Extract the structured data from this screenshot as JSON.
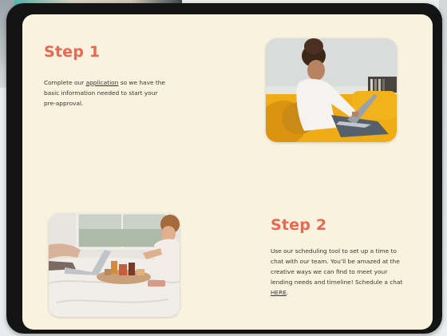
{
  "step1": {
    "title": "Step 1",
    "text_before_link": "Complete our ",
    "link_text": "application",
    "text_after_link": " so we have the basic information needed to start your pre-approval."
  },
  "step2": {
    "title": "Step 2",
    "text_before_link": "Use our scheduling tool to set up a time to chat with our team. You’ll be amazed at the creative ways we can find to meet your lending needs and timeline! Schedule a chat ",
    "link_text": "HERE",
    "text_after_link": "."
  },
  "colors": {
    "accent": "#ec6650",
    "page_background": "#f9f2df",
    "bezel": "#141414",
    "body_text": "#3a3530"
  }
}
